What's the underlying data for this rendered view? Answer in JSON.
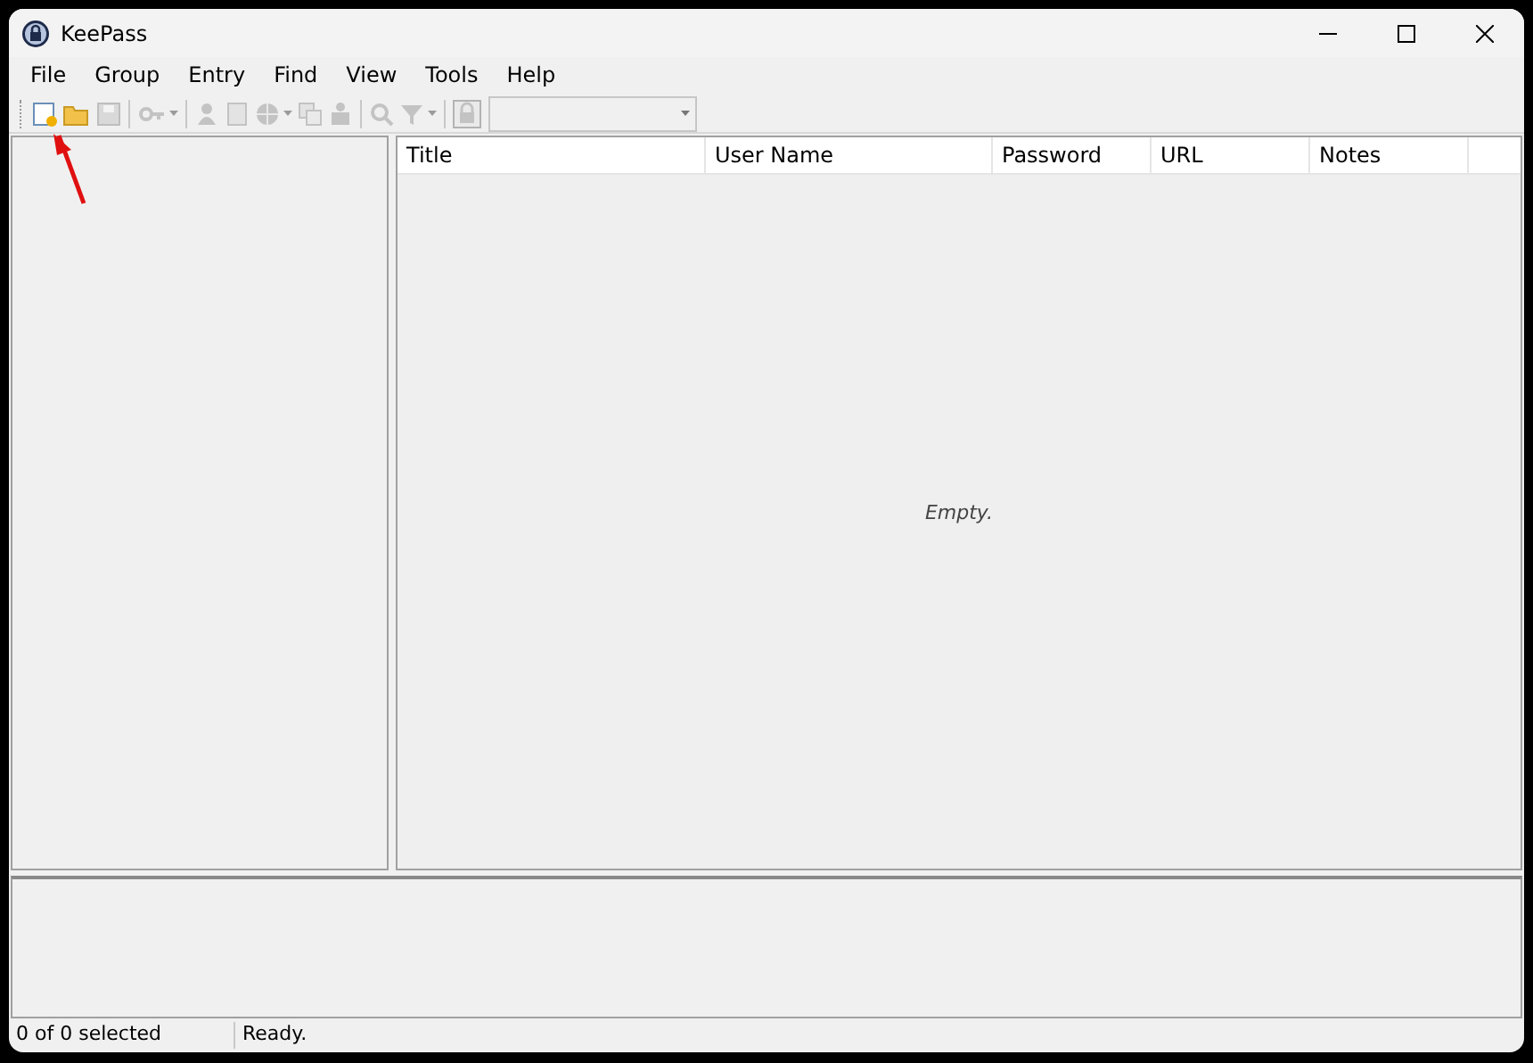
{
  "window": {
    "title": "KeePass"
  },
  "menu": [
    "File",
    "Group",
    "Entry",
    "Find",
    "View",
    "Tools",
    "Help"
  ],
  "toolbar": [
    {
      "kind": "new",
      "disabled": false
    },
    {
      "kind": "open",
      "disabled": false
    },
    {
      "kind": "save",
      "disabled": true
    },
    {
      "kind": "sep"
    },
    {
      "kind": "key",
      "disabled": true,
      "dropdown": true
    },
    {
      "kind": "sep"
    },
    {
      "kind": "user",
      "disabled": true
    },
    {
      "kind": "doc",
      "disabled": true
    },
    {
      "kind": "globe",
      "disabled": true,
      "dropdown": true
    },
    {
      "kind": "copy",
      "disabled": true
    },
    {
      "kind": "person",
      "disabled": true
    },
    {
      "kind": "sep"
    },
    {
      "kind": "search",
      "disabled": true
    },
    {
      "kind": "filter",
      "disabled": true,
      "dropdown": true
    },
    {
      "kind": "sep"
    },
    {
      "kind": "lock",
      "disabled": true
    }
  ],
  "quick_search": {
    "disabled": true
  },
  "table": {
    "columns": [
      "Title",
      "User Name",
      "Password",
      "URL",
      "Notes"
    ],
    "empty_text": "Empty."
  },
  "status_bar": {
    "selection": "0 of 0 selected",
    "message": "Ready."
  }
}
